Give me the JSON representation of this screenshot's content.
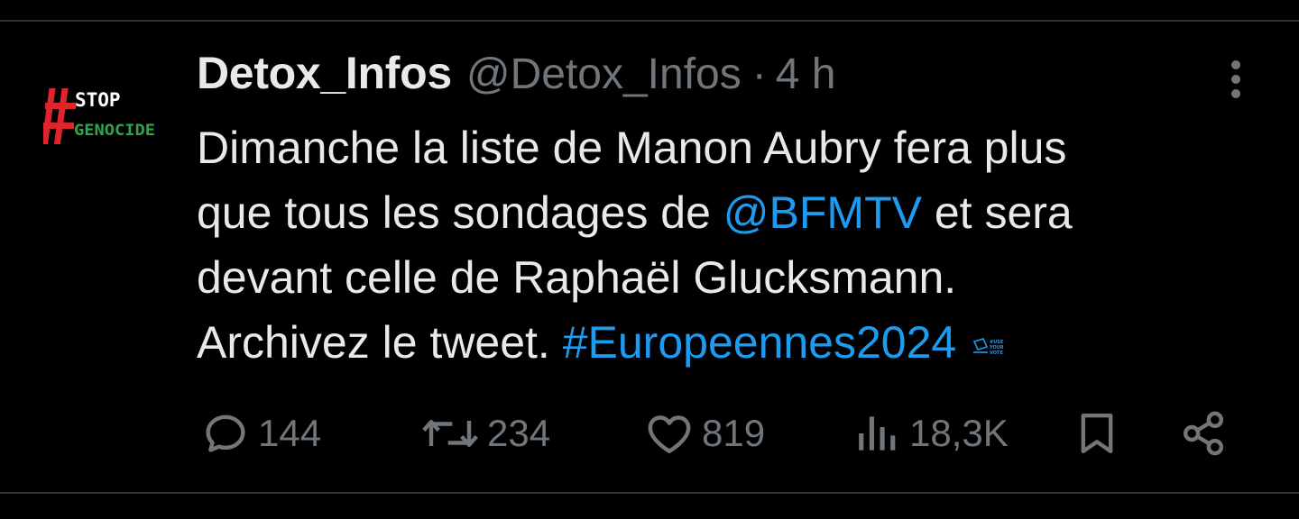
{
  "tweet": {
    "display_name": "Detox_Infos",
    "handle": "@Detox_Infos",
    "separator": "·",
    "time": "4 h",
    "avatar": {
      "icon": "stop-genocide-avatar-icon",
      "text_top": "STOP",
      "text_bottom": "GENOCIDE"
    },
    "body": {
      "line1": "Dimanche la liste de Manon Aubry fera plus",
      "line2_pre": "que tous les sondages de ",
      "mention": "@BFMTV",
      "line2_post": " et sera",
      "line3": "devant celle de Raphaël Glucksmann.",
      "line4_pre": "Archivez le tweet. ",
      "hashtag": "#Europeennes2024",
      "hashtag_emoji": {
        "icon": "use-your-vote-icon",
        "text": "#USE YOUR VOTE"
      }
    },
    "metrics": {
      "replies": "144",
      "retweets": "234",
      "likes": "819",
      "views": "18,3K"
    }
  },
  "colors": {
    "background": "#000000",
    "text_primary": "#e7e9ea",
    "text_secondary": "#71767b",
    "link": "#1d9bf0",
    "divider": "#2f3336",
    "avatar_red": "#e0242b",
    "avatar_green": "#2aa84a"
  }
}
